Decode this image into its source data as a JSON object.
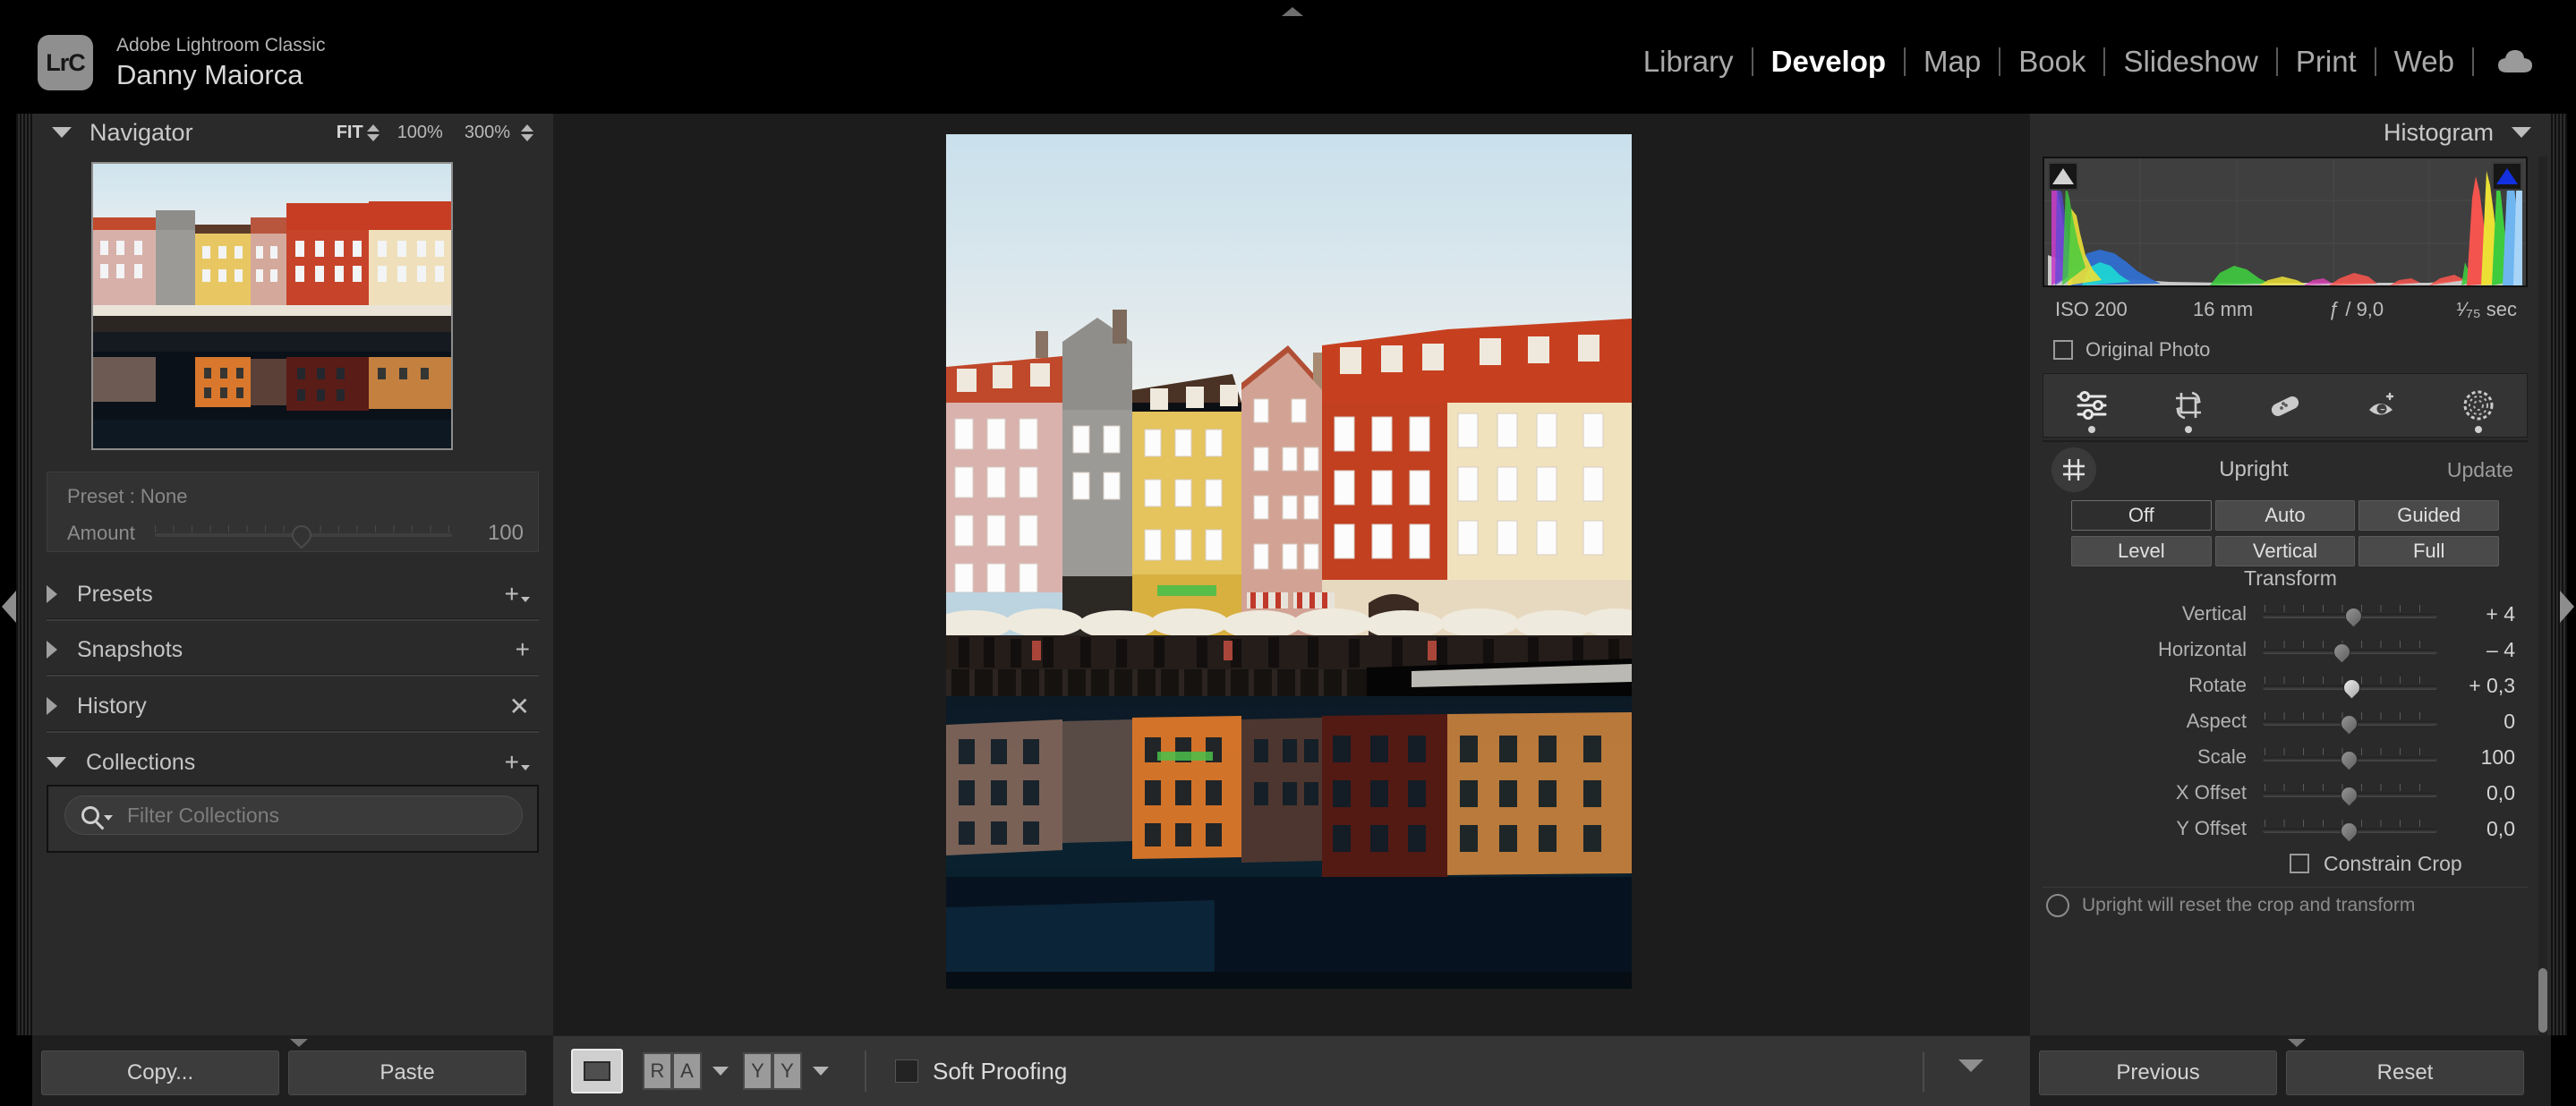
{
  "app": {
    "logo_text": "LrC",
    "name": "Adobe Lightroom Classic",
    "user": "Danny Maiorca"
  },
  "modules": [
    {
      "label": "Library",
      "active": false
    },
    {
      "label": "Develop",
      "active": true
    },
    {
      "label": "Map",
      "active": false
    },
    {
      "label": "Book",
      "active": false
    },
    {
      "label": "Slideshow",
      "active": false
    },
    {
      "label": "Print",
      "active": false
    },
    {
      "label": "Web",
      "active": false
    }
  ],
  "cloud_icon": "cloud-sync-icon",
  "navigator": {
    "title": "Navigator",
    "zoom_fit": "FIT",
    "zoom_100": "100%",
    "zoom_300": "300%"
  },
  "preset_panel": {
    "preset_label": "Preset : None",
    "amount_label": "Amount",
    "amount_value": "100"
  },
  "left_sections": [
    {
      "label": "Presets",
      "expanded": false,
      "action": "plus-dropdown-icon"
    },
    {
      "label": "Snapshots",
      "expanded": false,
      "action": "plus-icon"
    },
    {
      "label": "History",
      "expanded": false,
      "action": "clear-x-icon"
    },
    {
      "label": "Collections",
      "expanded": true,
      "action": "plus-dropdown-icon"
    }
  ],
  "collections": {
    "filter_placeholder": "Filter Collections",
    "search_icon": "search-icon"
  },
  "left_footer": {
    "copy_label": "Copy...",
    "paste_label": "Paste"
  },
  "histogram": {
    "title": "Histogram",
    "shadow_clip_icon": "shadow-clipping-triangle",
    "highlight_clip_icon": "highlight-clipping-triangle",
    "exif": {
      "iso": "ISO 200",
      "focal_length": "16 mm",
      "aperture": "ƒ / 9,0",
      "shutter": "¹⁄₇₅ sec"
    },
    "original_photo_label": "Original Photo",
    "original_photo_checked": false
  },
  "tool_strip": [
    {
      "name": "basic-adjustments-icon",
      "active": true
    },
    {
      "name": "crop-overlay-icon",
      "active": true
    },
    {
      "name": "healing-brush-icon",
      "active": false
    },
    {
      "name": "red-eye-correction-icon",
      "active": false
    },
    {
      "name": "masking-icon",
      "active": true
    }
  ],
  "upright": {
    "icon": "upright-grid-icon",
    "title": "Upright",
    "update_label": "Update",
    "modes_row1": [
      {
        "label": "Off",
        "selected": true
      },
      {
        "label": "Auto",
        "selected": false
      },
      {
        "label": "Guided",
        "selected": false
      }
    ],
    "modes_row2": [
      {
        "label": "Level",
        "selected": false
      },
      {
        "label": "Vertical",
        "selected": false
      },
      {
        "label": "Full",
        "selected": false
      }
    ]
  },
  "transform": {
    "title": "Transform",
    "sliders": [
      {
        "label": "Vertical",
        "value": "+ 4",
        "pos": 52,
        "highlight": false
      },
      {
        "label": "Horizontal",
        "value": "– 4",
        "pos": 45,
        "highlight": false
      },
      {
        "label": "Rotate",
        "value": "+ 0,3",
        "pos": 51,
        "highlight": true
      },
      {
        "label": "Aspect",
        "value": "0",
        "pos": 49,
        "highlight": false
      },
      {
        "label": "Scale",
        "value": "100",
        "pos": 49,
        "highlight": false
      },
      {
        "label": "X Offset",
        "value": "0,0",
        "pos": 49,
        "highlight": false
      },
      {
        "label": "Y Offset",
        "value": "0,0",
        "pos": 49,
        "highlight": false
      }
    ],
    "constrain_crop_label": "Constrain Crop",
    "constrain_crop_checked": false,
    "hint_text": "Upright will reset the crop and transform"
  },
  "toolbar": {
    "loupe_view_icon": "loupe-view-icon",
    "flag_rating_label_a": "R",
    "flag_rating_label_b": "A",
    "color_label_a": "Y",
    "color_label_b": "Y",
    "soft_proofing_label": "Soft Proofing",
    "soft_proofing_checked": false
  },
  "right_footer": {
    "previous_label": "Previous",
    "reset_label": "Reset"
  },
  "photo": {
    "description": "Nyhavn waterfront Copenhagen with colourful townhouses and mirrored reflection in canal"
  }
}
